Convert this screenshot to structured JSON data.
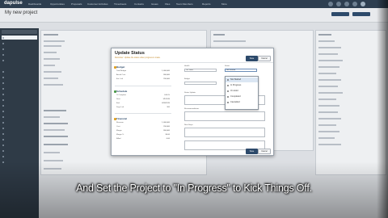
{
  "app": {
    "logo": "dapulse"
  },
  "nav": {
    "items": [
      "Dashboards",
      "Opportunities",
      "Proposals",
      "Customer Activities",
      "Timesheets",
      "Contacts",
      "Issues",
      "Files",
      "Team Members",
      "Reports",
      "More"
    ]
  },
  "page": {
    "title": "My new project"
  },
  "modal": {
    "title": "Update Status",
    "subtitle": "Reminder: Update the status when progress is made.",
    "save_label": "Save",
    "cancel_label": "Cancel",
    "sections": {
      "budget": {
        "title": "Budget",
        "rows": [
          {
            "label": "Total Budget",
            "value": "1,000,000"
          },
          {
            "label": "Actual Cost",
            "value": "300,000"
          },
          {
            "label": "Est. Left",
            "value": "700,000"
          }
        ]
      },
      "schedule": {
        "title": "Schedule",
        "rows": [
          {
            "label": "% Complete",
            "value": "0.00 %"
          },
          {
            "label": "Start",
            "value": "1/1/2015"
          },
          {
            "label": "End",
            "value": "6/30/2015"
          },
          {
            "label": "Days Left",
            "value": "181"
          }
        ]
      },
      "financial": {
        "title": "Financial",
        "rows": [
          {
            "label": "Revenue",
            "value": "1,000,000"
          },
          {
            "label": "Cost",
            "value": "700,000"
          },
          {
            "label": "Margin",
            "value": "300,000"
          },
          {
            "label": "Margin %",
            "value": "30.00"
          },
          {
            "label": "Billed",
            "value": "0.00"
          }
        ]
      }
    },
    "status_label": "Status",
    "status_value": "Not Started",
    "health_label": "Health",
    "health_value": "On Track",
    "fields": [
      "Budget",
      "Status Update",
      "Recommendations",
      "Next Steps"
    ]
  },
  "dropdown": {
    "options": [
      "Not Started",
      "In Progress",
      "On Hold",
      "Completed",
      "Cancelled"
    ],
    "selected": "Not Started"
  },
  "caption": "And Set the Project to \"In Progress\" to Kick Things Off."
}
